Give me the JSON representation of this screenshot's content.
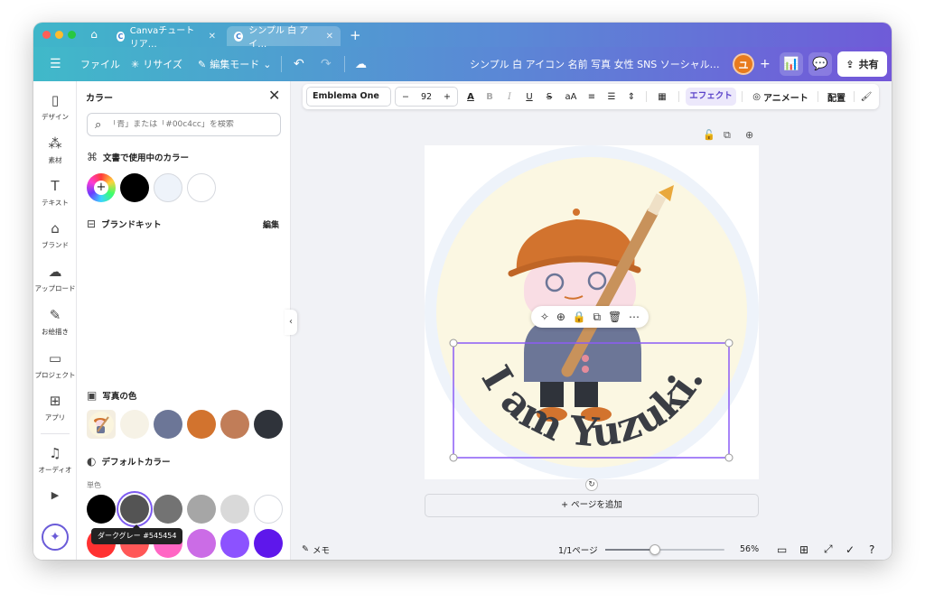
{
  "tabs": [
    {
      "label": "Canvaチュートリア…",
      "active": false
    },
    {
      "label": "シンプル 白 アイ…",
      "active": true
    }
  ],
  "toolbar": {
    "file": "ファイル",
    "resize": "リサイズ",
    "edit_mode": "編集モード",
    "design_title": "シンプル 白 アイコン 名前 写真 女性 SNS ソーシャル…",
    "avatar_initial": "ユ",
    "share": "共有"
  },
  "rail": [
    {
      "label": "デザイン",
      "icon": "layout-icon"
    },
    {
      "label": "素材",
      "icon": "elements-icon"
    },
    {
      "label": "テキスト",
      "icon": "text-icon"
    },
    {
      "label": "ブランド",
      "icon": "brand-icon"
    },
    {
      "label": "アップロード",
      "icon": "upload-icon"
    },
    {
      "label": "お絵描き",
      "icon": "draw-icon"
    },
    {
      "label": "プロジェクト",
      "icon": "folder-icon"
    },
    {
      "label": "アプリ",
      "icon": "apps-icon"
    },
    {
      "label": "オーディオ",
      "icon": "audio-icon"
    },
    {
      "label": "",
      "icon": "video-icon"
    }
  ],
  "panel": {
    "title": "カラー",
    "search_placeholder": "「青」または「#00c4cc」を検索",
    "doc_colors_heading": "文書で使用中のカラー",
    "brand_kit_heading": "ブランドキット",
    "brand_kit_edit": "編集",
    "photo_colors_heading": "写真の色",
    "default_colors_heading": "デフォルトカラー",
    "solid_label": "単色",
    "tooltip": "ダークグレー #545454"
  },
  "doc_colors": [
    "#000000",
    "#eef3fa",
    "#ffffff"
  ],
  "photo_colors": [
    "#f6f2e6",
    "#6c7697",
    "#d2732e",
    "#c17d58",
    "#2f333a"
  ],
  "default_colors_row1": [
    "#000000",
    "#545454",
    "#737373",
    "#a6a6a6",
    "#d9d9d9",
    "#ffffff"
  ],
  "default_colors_row2": [
    "#ff3131",
    "#ff5757",
    "#ff66c4",
    "#cb6ce6",
    "#8c52ff",
    "#5e17eb"
  ],
  "fmt": {
    "font": "Emblema One",
    "size": "92",
    "effects": "エフェクト",
    "animate": "アニメート",
    "position": "配置"
  },
  "canvas": {
    "curved_text": "I am Yuzuki.",
    "add_page": "+ ページを追加"
  },
  "bottombar": {
    "notes": "メモ",
    "page_count": "1/1ページ",
    "zoom": "56%",
    "zoom_fraction": 0.42
  }
}
